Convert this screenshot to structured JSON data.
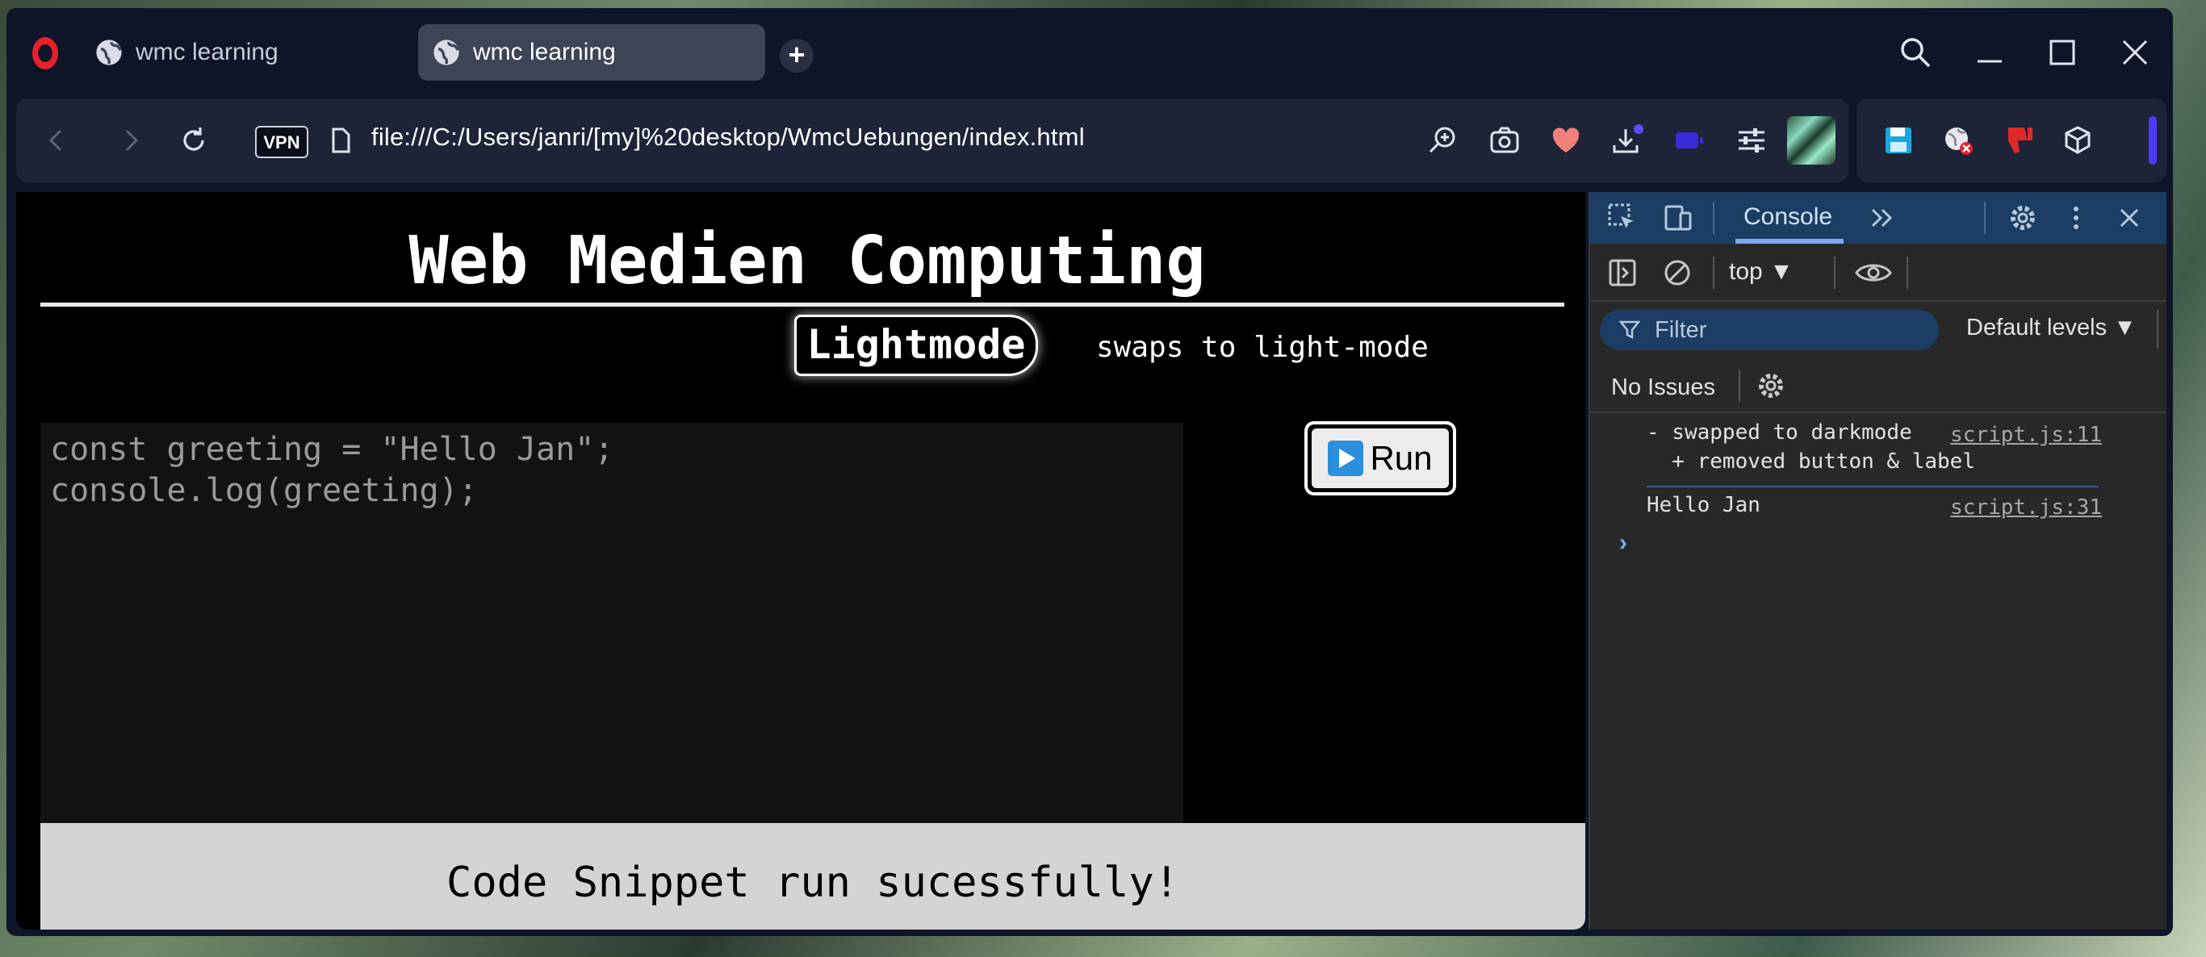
{
  "browser": {
    "tabs": [
      {
        "label": "wmc learning",
        "active": false
      },
      {
        "label": "wmc learning",
        "active": true
      }
    ],
    "new_tab_symbol": "+",
    "vpn_label": "VPN",
    "url": "file:///C:/Users/janri/[my]%20desktop/WmcUebungen/index.html",
    "icons": [
      "opera-logo-icon",
      "globe-icon",
      "search-icon",
      "minimize-icon",
      "maximize-icon",
      "close-icon",
      "back-icon",
      "forward-icon",
      "reload-icon",
      "page-icon",
      "zoom-icon",
      "camera-icon",
      "heart-icon",
      "download-icon",
      "battery-icon",
      "settings-sliders-icon",
      "wallpaper-thumbnail",
      "save-icon",
      "globe-blocked-icon",
      "thumbs-down-icon",
      "cube-icon"
    ],
    "accent": "#e8202c"
  },
  "page": {
    "title": "Web Medien Computing",
    "mode_button": "Lightmode",
    "mode_label": "swaps to light-mode",
    "code_lines": "const greeting = \"Hello Jan\";\nconsole.log(greeting);",
    "run_button": "Run",
    "status": "Code Snippet run sucessfully!"
  },
  "devtools": {
    "active_tab": "Console",
    "context": "top",
    "filter_placeholder": "Filter",
    "levels": "Default levels",
    "issues": "No Issues",
    "logs": [
      {
        "message": "- swapped to darkmode\n  + removed button & label",
        "source": "script.js:11"
      },
      {
        "message": "Hello Jan",
        "source": "script.js:31"
      }
    ],
    "prompt": "›"
  }
}
